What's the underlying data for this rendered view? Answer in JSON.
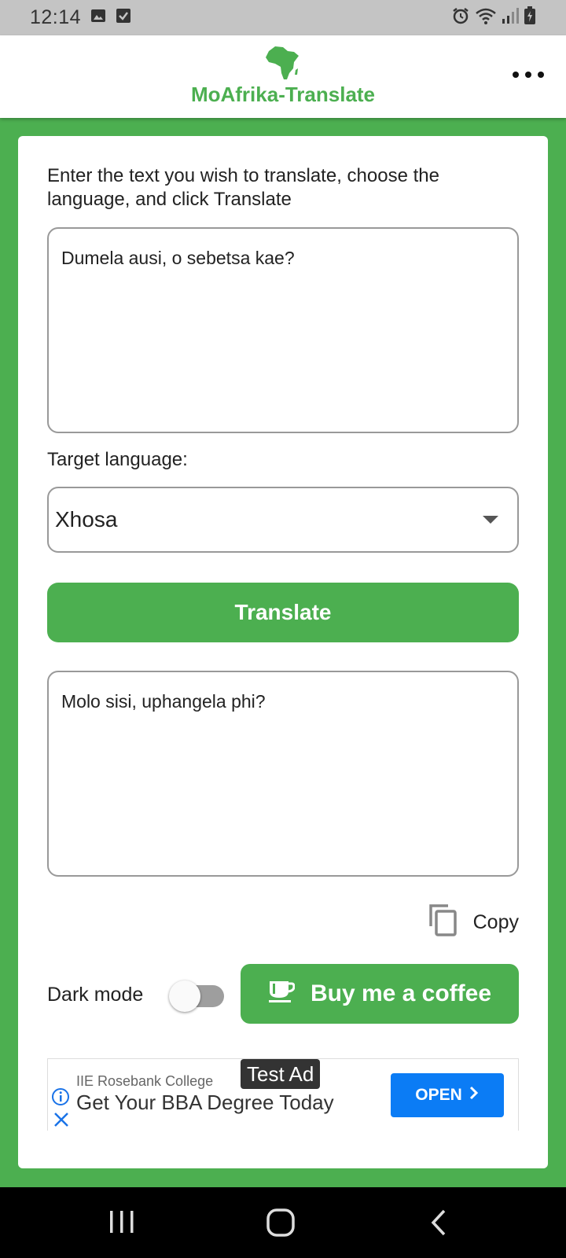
{
  "status_bar": {
    "time": "12:14",
    "left_icons": [
      "image-icon",
      "checkbox-icon"
    ],
    "right_icons": [
      "alarm-icon",
      "wifi-icon",
      "signal-icon",
      "battery-charging-icon"
    ]
  },
  "app_bar": {
    "title": "MoAfrika-Translate",
    "logo_icon": "africa-map-icon",
    "menu_icon": "more-horizontal-icon"
  },
  "form": {
    "instructions": "Enter the text you wish to translate, choose the language, and click Translate",
    "input_text": "Dumela ausi, o sebetsa kae?",
    "target_label": "Target language:",
    "target_language": "Xhosa",
    "translate_label": "Translate",
    "output_text": "Molo sisi, uphangela phi?",
    "copy_label": "Copy",
    "dark_mode_label": "Dark mode",
    "dark_mode_on": false,
    "coffee_label": "Buy me a coffee"
  },
  "ad": {
    "tag": "Test Ad",
    "advertiser": "IIE Rosebank College",
    "headline": "Get Your BBA Degree Today",
    "cta": "OPEN"
  },
  "colors": {
    "accent": "#4caf50",
    "ad_button": "#0b7cf5",
    "status_bar": "#c4c4c4",
    "nav_bar": "#000000"
  },
  "nav_bar": [
    "recent-apps-icon",
    "home-icon",
    "back-icon"
  ]
}
